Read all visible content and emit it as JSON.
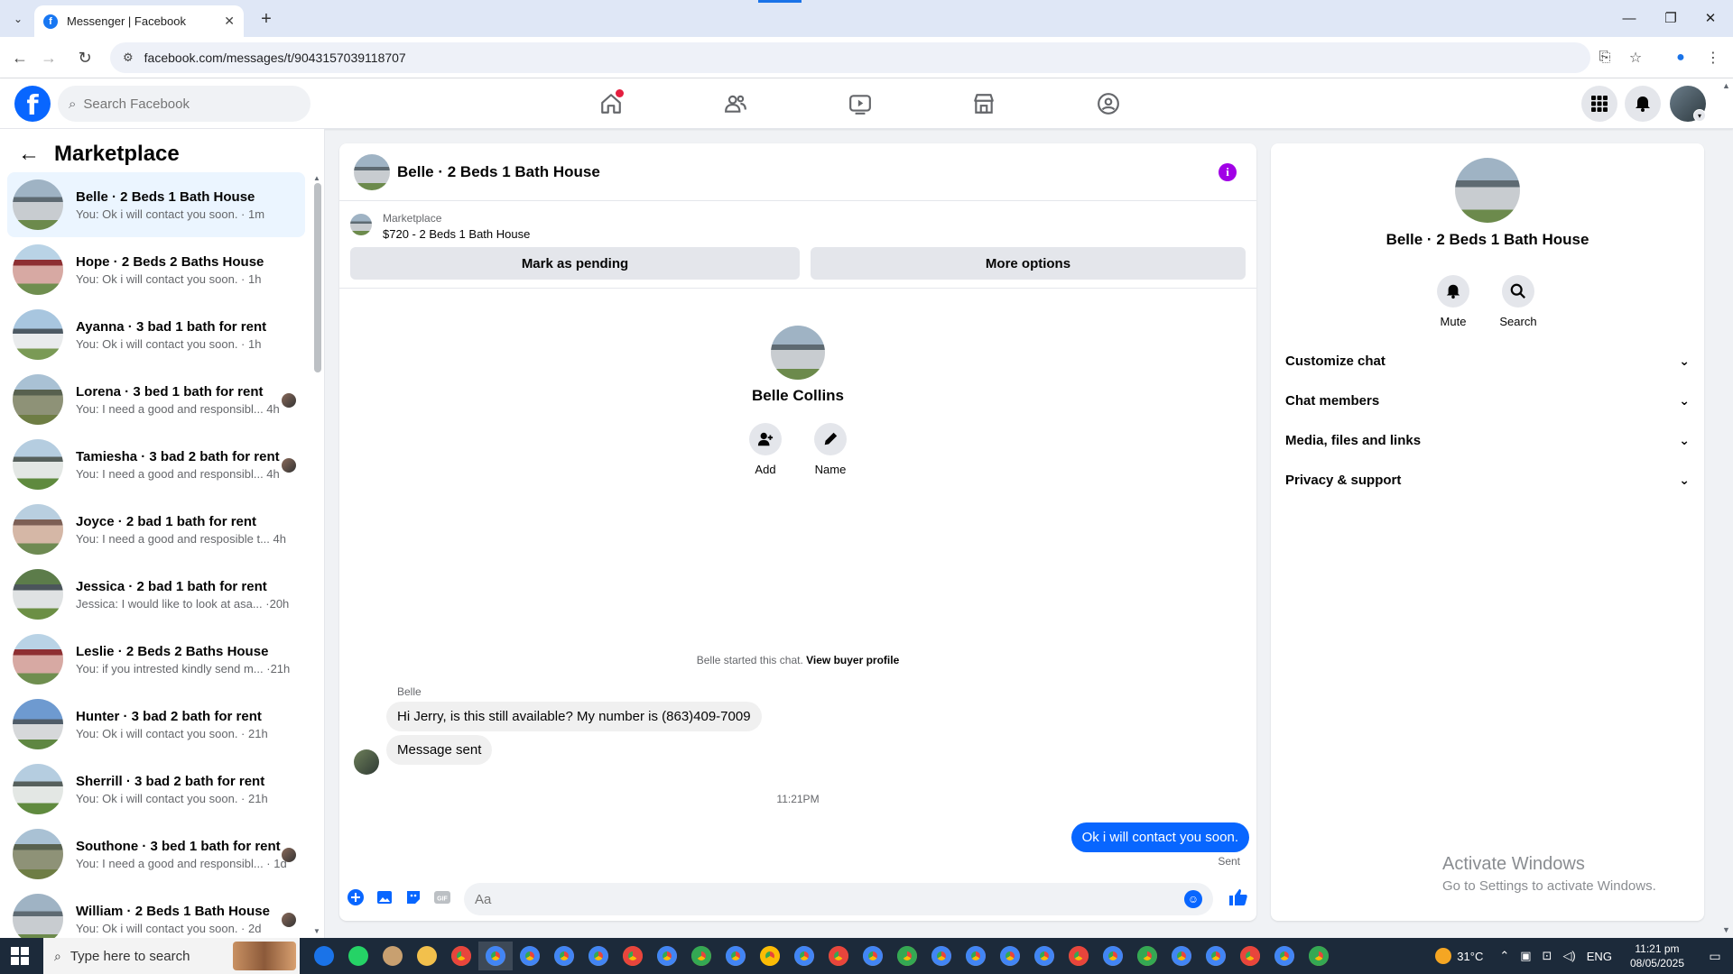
{
  "browser": {
    "tab_title": "Messenger | Facebook",
    "url": "facebook.com/messages/t/9043157039118707"
  },
  "header": {
    "search_placeholder": "Search Facebook"
  },
  "sidebar": {
    "title": "Marketplace",
    "conversations": [
      {
        "title": "Belle · 2 Beds 1 Bath House",
        "preview": "You: Ok i will contact you soon. · 1m",
        "thumb": "house-gray",
        "seen": false,
        "active": true
      },
      {
        "title": "Hope · 2 Beds 2 Baths House",
        "preview": "You: Ok i will contact you soon. · 1h",
        "thumb": "house-red",
        "seen": false,
        "active": false
      },
      {
        "title": "Ayanna · 3 bad 1 bath for rent",
        "preview": "You: Ok i will contact you soon. · 1h",
        "thumb": "house-white",
        "seen": false,
        "active": false
      },
      {
        "title": "Lorena · 3 bed 1 bath for rent",
        "preview": "You: I need a good and responsibl...  4h",
        "thumb": "house-olive",
        "seen": true,
        "active": false
      },
      {
        "title": "Tamiesha · 3 bad 2 bath for rent",
        "preview": "You: I need a good and responsibl...  4h",
        "thumb": "house-green",
        "seen": true,
        "active": false
      },
      {
        "title": "Joyce · 2 bad 1 bath for rent",
        "preview": "You: I need a good and resposible t...  4h",
        "thumb": "house-tan",
        "seen": false,
        "active": false
      },
      {
        "title": "Jessica · 2 bad 1 bath for rent",
        "preview": "Jessica: I would like to look at asa... ·20h",
        "thumb": "house-tree",
        "seen": false,
        "active": false
      },
      {
        "title": "Leslie · 2 Beds 2 Baths House",
        "preview": "You: if you intrested kindly send m... ·21h",
        "thumb": "house-red",
        "seen": false,
        "active": false
      },
      {
        "title": "Hunter · 3 bad 2 bath for rent",
        "preview": "You: Ok i will contact you soon. · 21h",
        "thumb": "house-blue",
        "seen": false,
        "active": false
      },
      {
        "title": "Sherrill · 3 bad 2 bath for rent",
        "preview": "You: Ok i will contact you soon. · 21h",
        "thumb": "house-green",
        "seen": false,
        "active": false
      },
      {
        "title": "Southone · 3 bed 1 bath for rent",
        "preview": "You: I need a good and responsibl... · 1d",
        "thumb": "house-olive",
        "seen": true,
        "active": false
      },
      {
        "title": "William · 2 Beds 1 Bath House",
        "preview": "You: Ok i will contact you soon. · 2d",
        "thumb": "house-gray",
        "seen": true,
        "active": false
      }
    ]
  },
  "chat": {
    "title": "Belle · 2 Beds 1 Bath House",
    "listing_category": "Marketplace",
    "listing_price": "$720 - 2 Beds 1 Bath House",
    "mark_pending_label": "Mark as pending",
    "more_options_label": "More options",
    "contact_name": "Belle Collins",
    "add_label": "Add",
    "name_label": "Name",
    "started_text": "Belle started this chat.",
    "view_profile_label": "View buyer profile",
    "sender_name": "Belle",
    "message_1": "Hi Jerry, is this still available? My number is (863)409-7009",
    "message_2": "Message sent",
    "timestamp": "11:21PM",
    "outgoing_message": "Ok i will contact you soon.",
    "sent_label": "Sent",
    "composer_placeholder": "Aa"
  },
  "right_panel": {
    "name": "Belle · 2 Beds 1 Bath House",
    "mute_label": "Mute",
    "search_label": "Search",
    "sections": [
      "Customize chat",
      "Chat members",
      "Media, files and links",
      "Privacy & support"
    ],
    "activate_title": "Activate Windows",
    "activate_sub": "Go to Settings to activate Windows."
  },
  "taskbar": {
    "search_placeholder": "Type here to search",
    "temperature": "31°C",
    "language": "ENG",
    "time": "11:21 pm",
    "date": "08/05/2025"
  },
  "colors": {
    "brand_blue": "#0866ff",
    "active_row": "#ebf5ff",
    "info_purple": "#a100e6"
  }
}
